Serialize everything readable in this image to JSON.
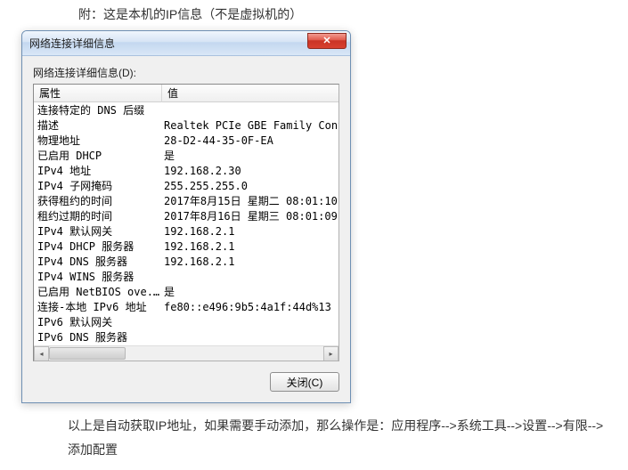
{
  "caption_top": "附：这是本机的IP信息（不是虚拟机的）",
  "caption_bottom": "以上是自动获取IP地址，如果需要手动添加，那么操作是：应用程序-->系统工具-->设置-->有限-->添加配置",
  "window": {
    "title": "网络连接详细信息",
    "section_label": "网络连接详细信息(D):",
    "close_button": "✕",
    "close_label": "关闭(C)",
    "headers": {
      "property": "属性",
      "value": "值"
    },
    "rows": [
      {
        "prop": "连接特定的 DNS 后缀",
        "val": ""
      },
      {
        "prop": "描述",
        "val": "Realtek PCIe GBE Family Contro"
      },
      {
        "prop": "物理地址",
        "val": "28-D2-44-35-0F-EA"
      },
      {
        "prop": "已启用 DHCP",
        "val": "是"
      },
      {
        "prop": "IPv4 地址",
        "val": "192.168.2.30"
      },
      {
        "prop": "IPv4 子网掩码",
        "val": "255.255.255.0"
      },
      {
        "prop": "获得租约的时间",
        "val": "2017年8月15日 星期二 08:01:10"
      },
      {
        "prop": "租约过期的时间",
        "val": "2017年8月16日 星期三 08:01:09"
      },
      {
        "prop": "IPv4 默认网关",
        "val": "192.168.2.1"
      },
      {
        "prop": "IPv4 DHCP 服务器",
        "val": "192.168.2.1"
      },
      {
        "prop": "IPv4 DNS 服务器",
        "val": "192.168.2.1"
      },
      {
        "prop": "IPv4 WINS 服务器",
        "val": ""
      },
      {
        "prop": "已启用 NetBIOS ove...",
        "val": "是"
      },
      {
        "prop": "连接-本地 IPv6 地址",
        "val": "fe80::e496:9b5:4a1f:44d%13"
      },
      {
        "prop": "IPv6 默认网关",
        "val": ""
      },
      {
        "prop": "IPv6 DNS 服务器",
        "val": ""
      }
    ]
  }
}
